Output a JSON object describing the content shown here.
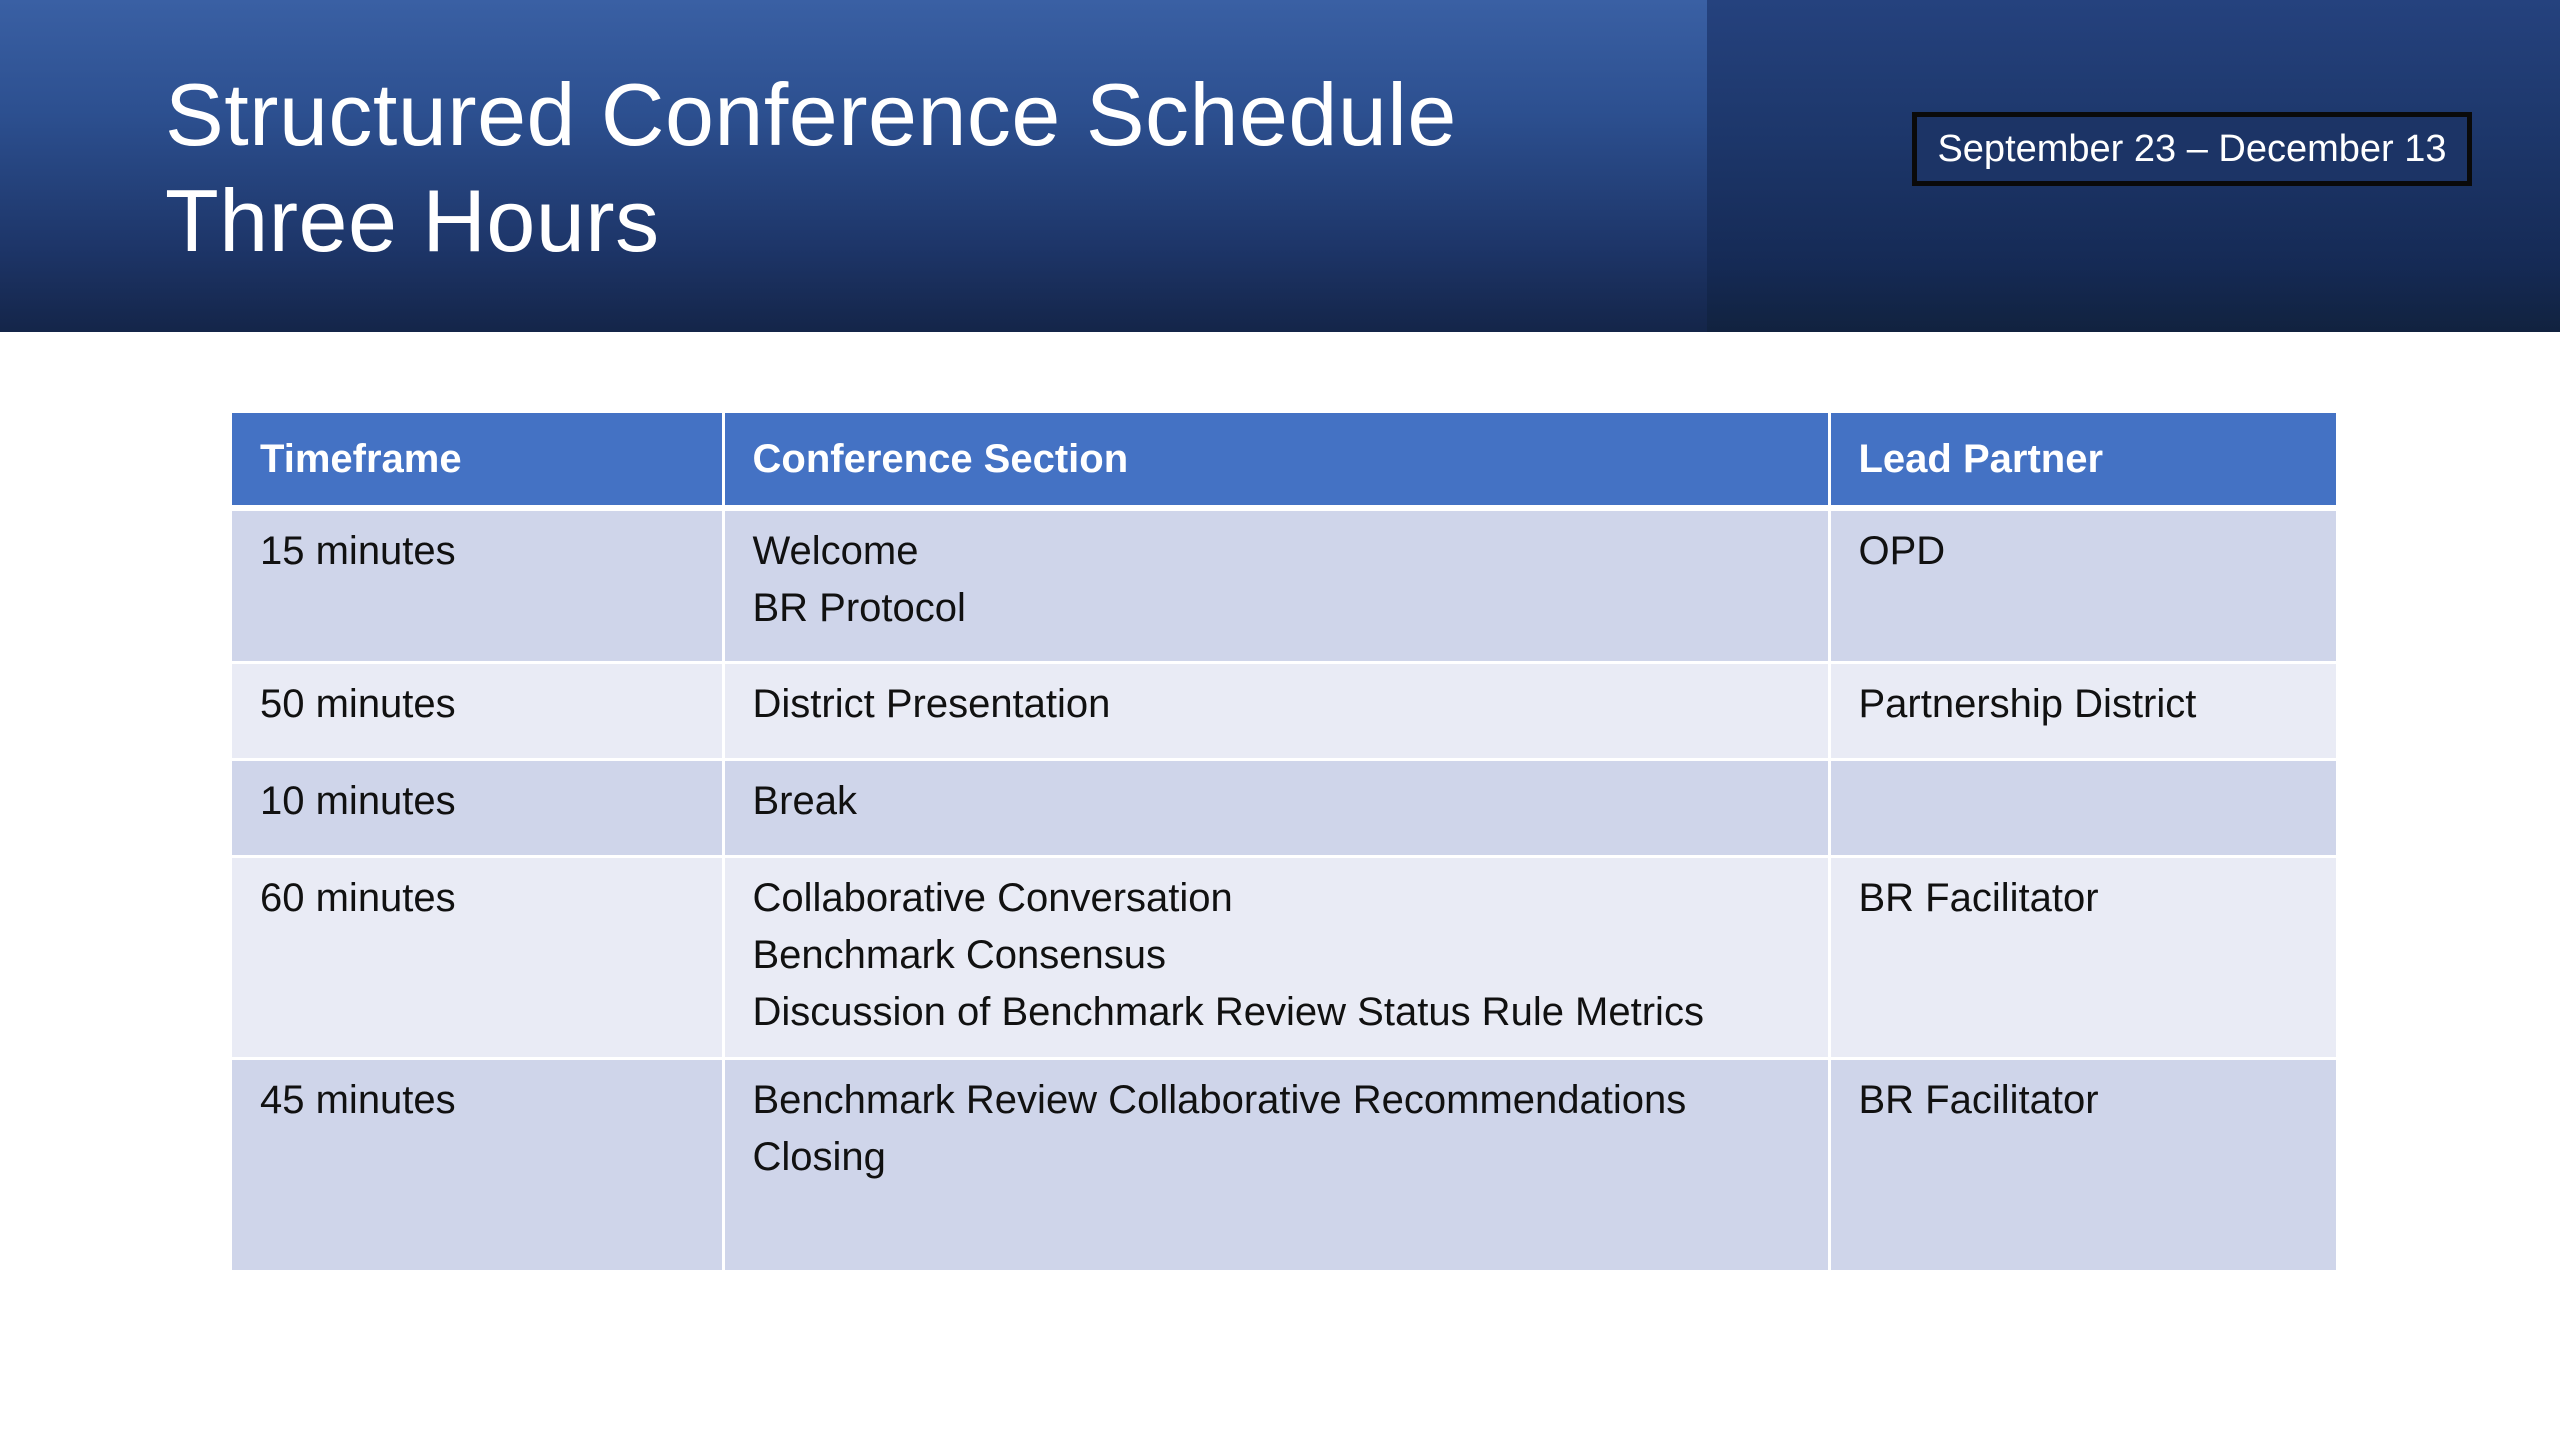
{
  "slide": {
    "title_line1": "Structured Conference Schedule",
    "title_line2": "Three Hours",
    "date_range": "September 23 – December 13"
  },
  "table": {
    "headers": [
      "Timeframe",
      "Conference Section",
      "Lead Partner"
    ],
    "rows": [
      {
        "timeframe": "15 minutes",
        "sections": [
          "Welcome",
          "BR Protocol"
        ],
        "lead": "OPD"
      },
      {
        "timeframe": "50 minutes",
        "sections": [
          "District Presentation"
        ],
        "lead": "Partnership District"
      },
      {
        "timeframe": "10 minutes",
        "sections": [
          "Break"
        ],
        "lead": ""
      },
      {
        "timeframe": "60 minutes",
        "sections": [
          "Collaborative Conversation",
          "Benchmark Consensus",
          "Discussion of Benchmark Review Status Rule Metrics"
        ],
        "lead": "BR Facilitator"
      },
      {
        "timeframe": "45 minutes",
        "sections": [
          "Benchmark Review Collaborative Recommendations",
          "Closing"
        ],
        "lead": "BR Facilitator"
      }
    ]
  },
  "colors": {
    "banner": "#2c4f8f",
    "header_row": "#4472c4",
    "row_dark": "#cfd5ea",
    "row_light": "#e9ebf5"
  }
}
